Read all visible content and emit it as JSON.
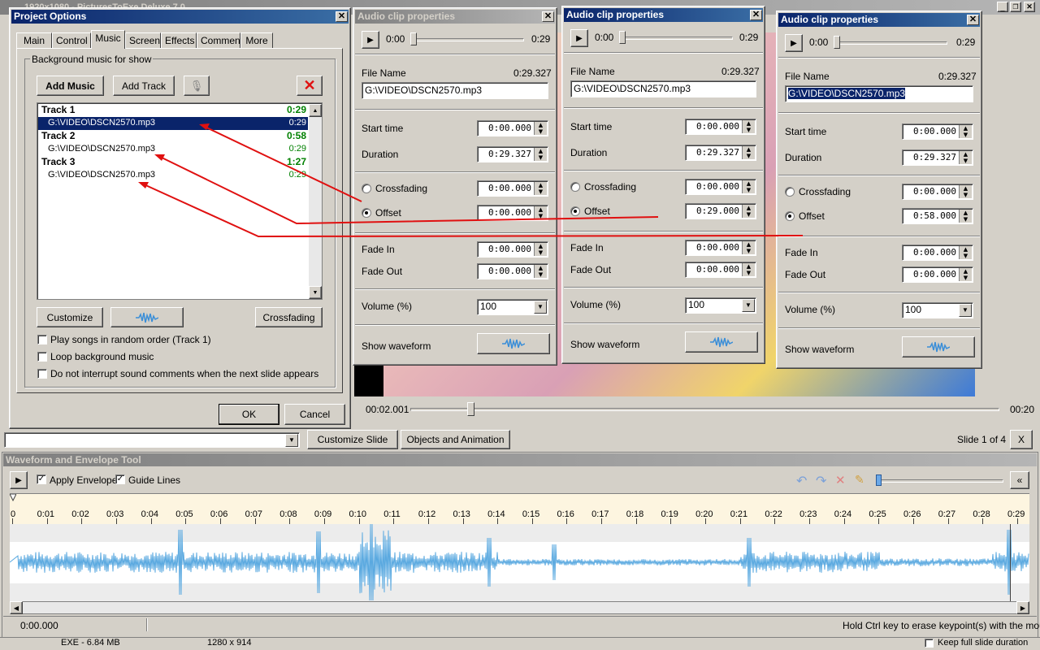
{
  "app": {
    "title_fragment": "1920x1080 - PicturesToExe Deluxe 7.0"
  },
  "project_options": {
    "title": "Project Options",
    "tabs": [
      {
        "label": "Main"
      },
      {
        "label": "Control"
      },
      {
        "label": "Music"
      },
      {
        "label": "Screen"
      },
      {
        "label": "Effects"
      },
      {
        "label": "Comments"
      },
      {
        "label": "More"
      }
    ],
    "group_title": "Background music for show",
    "add_music": "Add Music",
    "add_track": "Add Track",
    "tracks": [
      {
        "name": "Track 1",
        "total": "0:29",
        "file": "G:\\VIDEO\\DSCN2570.mp3",
        "dur": "0:29"
      },
      {
        "name": "Track 2",
        "total": "0:58",
        "file": "G:\\VIDEO\\DSCN2570.mp3",
        "dur": "0:29"
      },
      {
        "name": "Track 3",
        "total": "1:27",
        "file": "G:\\VIDEO\\DSCN2570.mp3",
        "dur": "0:29"
      }
    ],
    "customize": "Customize",
    "crossfading": "Crossfading",
    "options": [
      {
        "label": "Play songs in random order (Track 1)"
      },
      {
        "label": "Loop background music"
      },
      {
        "label": "Do not interrupt sound comments when the next slide appears"
      }
    ],
    "ok": "OK",
    "cancel": "Cancel"
  },
  "clip_windows": [
    {
      "title": "Audio clip properties",
      "time_start": "0:00",
      "time_end": "0:29",
      "file_label": "File Name",
      "file_dur": "0:29.327",
      "file": "G:\\VIDEO\\DSCN2570.mp3",
      "start_label": "Start time",
      "start": "0:00.000",
      "dur_label": "Duration",
      "dur": "0:29.327",
      "cross_label": "Crossfading",
      "cross": "0:00.000",
      "offset_label": "Offset",
      "offset": "0:00.000",
      "fadein_label": "Fade In",
      "fadein": "0:00.000",
      "fadeout_label": "Fade Out",
      "fadeout": "0:00.000",
      "vol_label": "Volume (%)",
      "vol": "100",
      "wave_label": "Show waveform"
    },
    {
      "title": "Audio clip properties",
      "time_start": "0:00",
      "time_end": "0:29",
      "file_label": "File Name",
      "file_dur": "0:29.327",
      "file": "G:\\VIDEO\\DSCN2570.mp3",
      "start_label": "Start time",
      "start": "0:00.000",
      "dur_label": "Duration",
      "dur": "0:29.327",
      "cross_label": "Crossfading",
      "cross": "0:00.000",
      "offset_label": "Offset",
      "offset": "0:29.000",
      "fadein_label": "Fade In",
      "fadein": "0:00.000",
      "fadeout_label": "Fade Out",
      "fadeout": "0:00.000",
      "vol_label": "Volume (%)",
      "vol": "100",
      "wave_label": "Show waveform"
    },
    {
      "title": "Audio clip properties",
      "time_start": "0:00",
      "time_end": "0:29",
      "file_label": "File Name",
      "file_dur": "0:29.327",
      "file": "G:\\VIDEO\\DSCN2570.mp3",
      "start_label": "Start time",
      "start": "0:00.000",
      "dur_label": "Duration",
      "dur": "0:29.327",
      "cross_label": "Crossfading",
      "cross": "0:00.000",
      "offset_label": "Offset",
      "offset": "0:58.000",
      "fadein_label": "Fade In",
      "fadein": "0:00.000",
      "fadeout_label": "Fade Out",
      "fadeout": "0:00.000",
      "vol_label": "Volume (%)",
      "vol": "100",
      "wave_label": "Show waveform"
    }
  ],
  "preview": {
    "time": "00:02.001",
    "end": "00:20"
  },
  "slide_bar": {
    "customize": "Customize Slide",
    "objects": "Objects and Animation",
    "slide_info": "Slide 1 of 4",
    "close": "X"
  },
  "waveform": {
    "title": "Waveform and Envelope Tool",
    "apply_envelope": "Apply Envelope",
    "guide_lines": "Guide Lines",
    "ticks": [
      "0",
      "0:01",
      "0:02",
      "0:03",
      "0:04",
      "0:05",
      "0:06",
      "0:07",
      "0:08",
      "0:09",
      "0:10",
      "0:11",
      "0:12",
      "0:13",
      "0:14",
      "0:15",
      "0:16",
      "0:17",
      "0:18",
      "0:19",
      "0:20",
      "0:21",
      "0:22",
      "0:23",
      "0:24",
      "0:25",
      "0:26",
      "0:27",
      "0:28",
      "0:29"
    ],
    "status_time": "0:00.000",
    "hint": "Hold Ctrl key to erase keypoint(s) with the mouse"
  },
  "bottom_status": {
    "exe": "EXE - 6.84 MB",
    "res": "1280 x 914",
    "keep": "Keep full slide duration"
  },
  "colors": {
    "title_active": "#0a246a",
    "track_green": "#008000",
    "arrow_red": "#e01010",
    "wave_blue": "#5aa9e0",
    "selection": "#0a246a"
  }
}
